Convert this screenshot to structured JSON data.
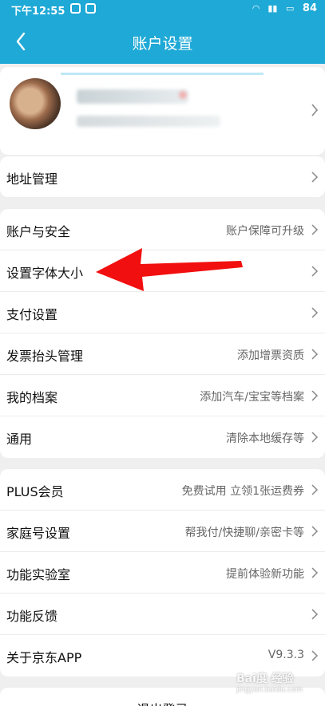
{
  "status_bar": {
    "time": "下午12:55",
    "battery": "84"
  },
  "nav": {
    "title": "账户设置",
    "back_icon": "back-arrow-icon"
  },
  "groups": [
    {
      "items": [
        {
          "label": "地址管理",
          "value": ""
        }
      ]
    },
    {
      "items": [
        {
          "label": "账户与安全",
          "value": "账户保障可升级"
        },
        {
          "label": "设置字体大小",
          "value": ""
        },
        {
          "label": "支付设置",
          "value": ""
        },
        {
          "label": "发票抬头管理",
          "value": "添加增票资质"
        },
        {
          "label": "我的档案",
          "value": "添加汽车/宝宝等档案"
        },
        {
          "label": "通用",
          "value": "清除本地缓存等"
        }
      ]
    },
    {
      "items": [
        {
          "label": "PLUS会员",
          "value": "免费试用 立领1张运费券"
        },
        {
          "label": "家庭号设置",
          "value": "帮我付/快捷聊/亲密卡等"
        },
        {
          "label": "功能实验室",
          "value": "提前体验新功能"
        },
        {
          "label": "功能反馈",
          "value": ""
        },
        {
          "label": "关于京东APP",
          "value": "V9.3.3"
        }
      ]
    }
  ],
  "logout": {
    "label": "退出登录"
  },
  "annotation": {
    "color": "#ff0000"
  },
  "watermark": {
    "line1": "Bai度 经验",
    "line2": "jingyan.baidu.com"
  },
  "colors": {
    "accent": "#1fa9d6"
  }
}
